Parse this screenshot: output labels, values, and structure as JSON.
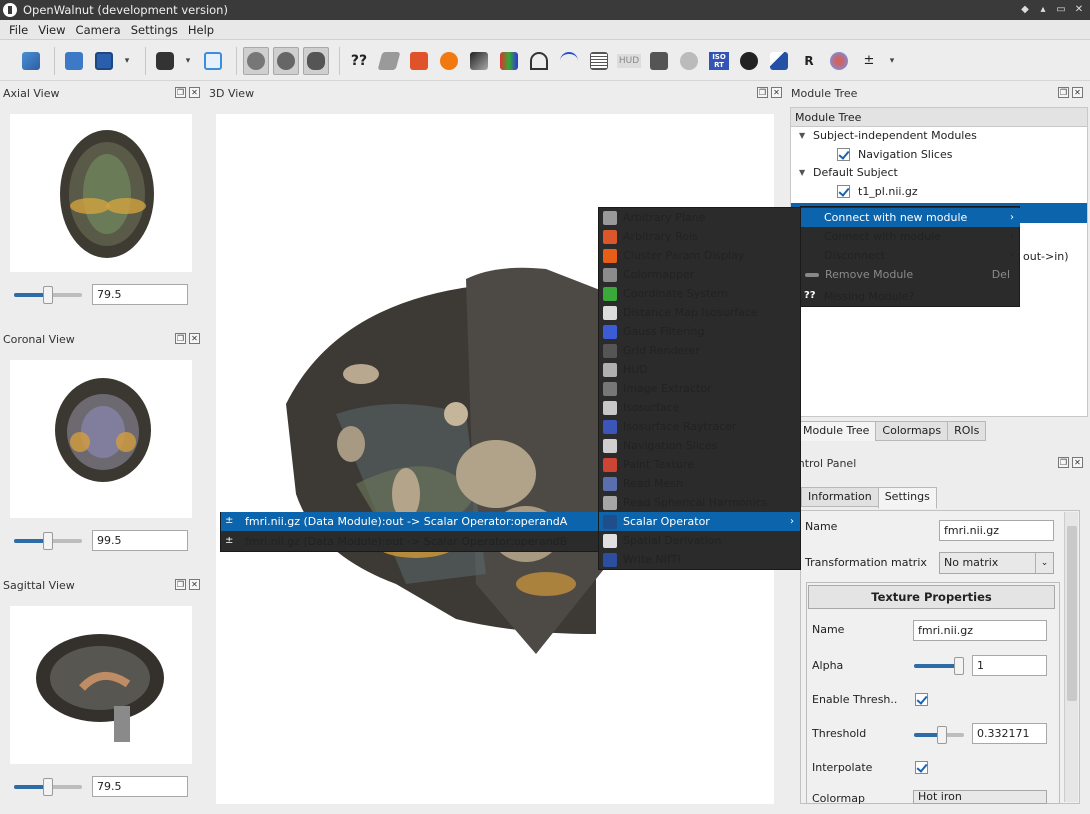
{
  "window": {
    "title": "OpenWalnut (development version)",
    "controls": [
      "◆",
      "▴",
      "▭",
      "✕"
    ]
  },
  "menubar": {
    "items": [
      "File",
      "View",
      "Camera",
      "Settings",
      "Help"
    ]
  },
  "toolbar": {
    "hud_label": "HUD",
    "isort_label": "ISO RT",
    "question_label": "??",
    "r_label": "R"
  },
  "docks": {
    "axial": {
      "title": "Axial View",
      "value": "79.5",
      "slider": 0.5
    },
    "coronal": {
      "title": "Coronal View",
      "value": "99.5",
      "slider": 0.5
    },
    "sagittal": {
      "title": "Sagittal View",
      "value": "79.5",
      "slider": 0.5
    },
    "view3d": {
      "title": "3D View"
    },
    "module_tree_dock": {
      "title": "Module Tree"
    }
  },
  "module_tree": {
    "header": "Module Tree",
    "rows": [
      {
        "label": "Subject-independent Modules"
      },
      {
        "label": "Navigation Slices"
      },
      {
        "label": "Default Subject"
      },
      {
        "label": "t1_pl.nii.gz"
      }
    ],
    "partial_text": "out->in)"
  },
  "tree_tabs": [
    "Module Tree",
    "Colormaps",
    "ROIs"
  ],
  "control_panel": {
    "title": "ontrol Panel",
    "tabs": [
      "Information",
      "Settings"
    ],
    "name_label": "Name",
    "name_value": "fmri.nii.gz",
    "transform_label": "Transformation matrix",
    "transform_value": "No matrix",
    "group_title": "Texture Properties",
    "tex_name_label": "Name",
    "tex_name_value": "fmri.nii.gz",
    "alpha_label": "Alpha",
    "alpha_value": "1",
    "alpha_slider": 1.0,
    "thresh_enable_label": "Enable Thresh..",
    "threshold_label": "Threshold",
    "threshold_value": "0.332171",
    "threshold_slider": 0.55,
    "interpolate_label": "Interpolate",
    "colormap_label": "Colormap",
    "colormap_value": "Hot iron"
  },
  "context_menu": {
    "items": [
      {
        "label": "Connect with new module",
        "sub": "›"
      },
      {
        "label": "Connect with module",
        "sub": "›"
      },
      {
        "label": "Disconnect",
        "sub": "›"
      },
      {
        "label": "Remove Module",
        "shortcut": "Del"
      },
      {
        "label": "Missing Module?"
      }
    ]
  },
  "module_menu": {
    "items": [
      {
        "label": "Arbitrary Plane",
        "color": "#9a9a9a"
      },
      {
        "label": "Arbitrary Rois",
        "color": "#d9572b"
      },
      {
        "label": "Cluster Param Display",
        "color": "#e85d18"
      },
      {
        "label": "Colormapper",
        "color": "#8c8c8c"
      },
      {
        "label": "Coordinate System",
        "color": "#3aa83a"
      },
      {
        "label": "Distance Map Isosurface",
        "color": "#dcdcdc"
      },
      {
        "label": "Gauss Filtering",
        "color": "#3c5bd6"
      },
      {
        "label": "Grid Renderer",
        "color": "#555555"
      },
      {
        "label": "HUD",
        "color": "#b0b0b0"
      },
      {
        "label": "Image Extractor",
        "color": "#777777"
      },
      {
        "label": "Isosurface",
        "color": "#c8c8c8"
      },
      {
        "label": "Isosurface Raytracer",
        "color": "#3b56b8"
      },
      {
        "label": "Navigation Slices",
        "color": "#cfcfcf"
      },
      {
        "label": "Paint Texture",
        "color": "#cc4433"
      },
      {
        "label": "Read Mesh",
        "color": "#5a6fb0"
      },
      {
        "label": "Read Spherical Harmonics",
        "color": "#a6a6a6"
      },
      {
        "label": "Scalar Operator",
        "color": "#1f4e8a",
        "sub": "›"
      },
      {
        "label": "Spatial Derivation",
        "color": "#e0e0e0"
      },
      {
        "label": "Write NIfTI",
        "color": "#2b4f9e"
      }
    ]
  },
  "connector_menu": {
    "items": [
      {
        "label": "fmri.nii.gz (Data Module):out -> Scalar Operator:operandA"
      },
      {
        "label": "fmri.nii.gz (Data Module):out -> Scalar Operator:operandB"
      }
    ]
  }
}
